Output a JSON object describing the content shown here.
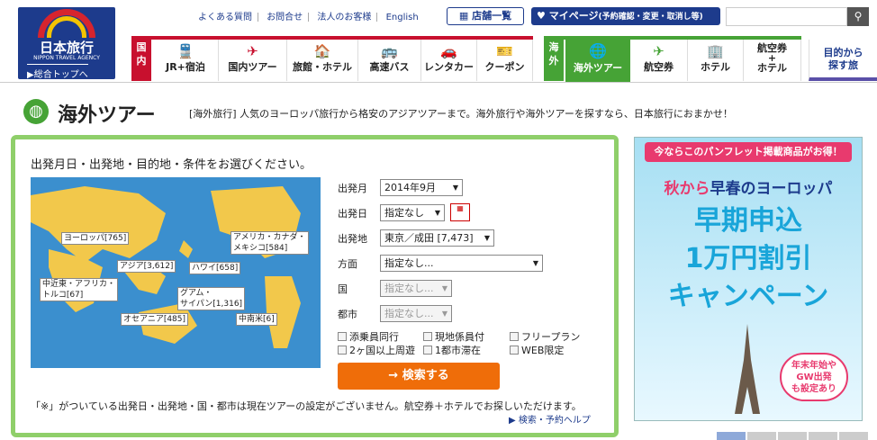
{
  "logo": {
    "name_jp": "日本旅行",
    "name_en": "NIPPON TRAVEL AGENCY",
    "top_link": "▶総合トップへ"
  },
  "util_links": [
    "よくある質問",
    "お問合せ",
    "法人のお客様",
    "English"
  ],
  "store_btn": "店舗一覧",
  "mypage": {
    "label": "マイページ",
    "sub": "(予約確認・変更・取消し等)"
  },
  "nav": {
    "domestic_label": "国内",
    "domestic": [
      {
        "icon": "🚆",
        "label": "JR+宿泊"
      },
      {
        "icon": "✈",
        "label": "国内ツアー"
      },
      {
        "icon": "🏠",
        "label": "旅館・ホテル"
      },
      {
        "icon": "🚌",
        "label": "高速バス"
      },
      {
        "icon": "🚗",
        "label": "レンタカー"
      },
      {
        "icon": "🎫",
        "label": "クーポン"
      }
    ],
    "overseas_label": "海外",
    "overseas_active": {
      "icon": "🌐",
      "label": "海外ツアー"
    },
    "overseas": [
      {
        "icon": "✈",
        "label": "航空券"
      },
      {
        "icon": "🏢",
        "label": "ホテル"
      },
      {
        "label": "航空券\n+\nホテル"
      }
    ],
    "purpose": "目的から\n探す旅"
  },
  "page": {
    "title": "海外ツアー",
    "desc": "[海外旅行] 人気のヨーロッパ旅行から格安のアジアツアーまで。海外旅行や海外ツアーを探すなら、日本旅行におまかせ！"
  },
  "form": {
    "prompt": "出発月日・出発地・目的地・条件をお選びください。",
    "regions": [
      "ヨーロッパ[765]",
      "アジア[3,612]",
      "中近東・アフリカ・\nトルコ[67]",
      "オセアニア[485]",
      "ハワイ[658]",
      "グアム・\nサイパン[1,316]",
      "アメリカ・カナダ・\nメキシコ[584]",
      "中南米[6]"
    ],
    "fields": {
      "month": {
        "label": "出発月",
        "value": "2014年9月"
      },
      "day": {
        "label": "出発日",
        "value": "指定なし"
      },
      "origin": {
        "label": "出発地",
        "value": "東京／成田 [7,473]"
      },
      "direction": {
        "label": "方面",
        "value": "指定なし..."
      },
      "country": {
        "label": "国",
        "value": "指定なし..."
      },
      "city": {
        "label": "都市",
        "value": "指定なし..."
      }
    },
    "checks": [
      "添乗員同行",
      "現地係員付",
      "フリープラン",
      "2ヶ国以上周遊",
      "1都市滞在",
      "WEB限定"
    ],
    "search_btn": "→ 検索する",
    "note": "「※」がついている出発日・出発地・国・都市は現在ツアーの設定がございません。航空券＋ホテルでお探しいただけます。",
    "help": "▶ 検索・予約ヘルプ"
  },
  "banner": {
    "head": "今ならこのパンフレット掲載商品がお得！",
    "sub_a": "秋から",
    "sub_b": "早春のヨーロッパ",
    "line1": "早期申込",
    "line2": "1万円割引",
    "line3": "キャンペーン",
    "tag": "年末年始や\nGW出発\nも設定あり"
  }
}
